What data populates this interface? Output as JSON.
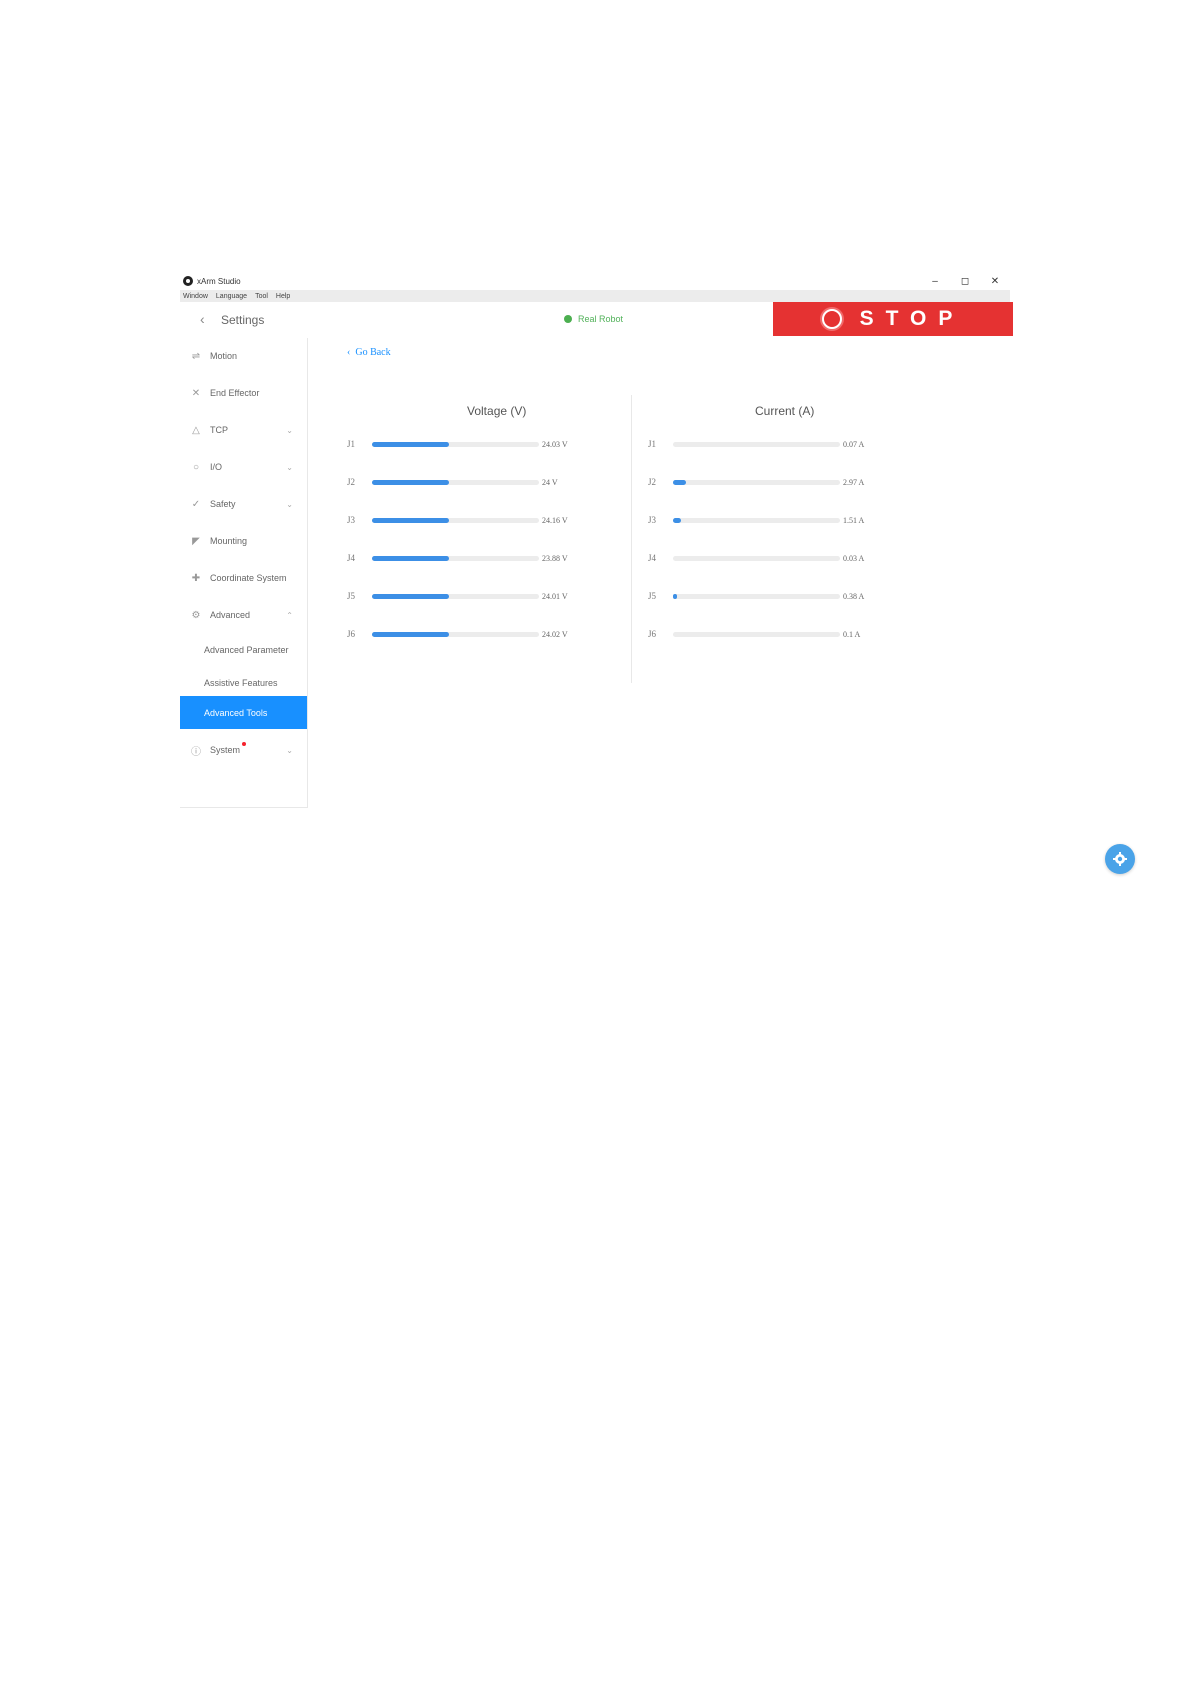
{
  "window": {
    "title": "xArm Studio"
  },
  "menu": [
    "Window",
    "Language",
    "Tool",
    "Help"
  ],
  "header": {
    "title": "Settings",
    "status": "Real Robot",
    "stop_label": "STOP"
  },
  "sidebar": {
    "items": [
      {
        "label": "Motion",
        "icon": "motion-icon"
      },
      {
        "label": "End Effector",
        "icon": "end-effector-icon"
      },
      {
        "label": "TCP",
        "icon": "tcp-icon"
      },
      {
        "label": "I/O",
        "icon": "io-icon"
      },
      {
        "label": "Safety",
        "icon": "safety-icon"
      },
      {
        "label": "Mounting",
        "icon": "mounting-icon"
      },
      {
        "label": "Coordinate System",
        "icon": "coordinate-system-icon"
      },
      {
        "label": "Advanced",
        "icon": "advanced-icon"
      }
    ],
    "sub_items": [
      "Advanced Parameter",
      "Assistive Features",
      "Advanced Tools"
    ],
    "active": "Advanced Tools",
    "system": {
      "label": "System",
      "icon": "info-icon"
    }
  },
  "main": {
    "go_back": "Go Back",
    "voltage": {
      "title": "Voltage (V)",
      "rows": [
        {
          "joint": "J1",
          "value": "24.03 V",
          "level": 0.46
        },
        {
          "joint": "J2",
          "value": "24 V",
          "level": 0.46
        },
        {
          "joint": "J3",
          "value": "24.16 V",
          "level": 0.46
        },
        {
          "joint": "J4",
          "value": "23.88 V",
          "level": 0.46
        },
        {
          "joint": "J5",
          "value": "24.01 V",
          "level": 0.46
        },
        {
          "joint": "J6",
          "value": "24.02 V",
          "level": 0.46
        }
      ]
    },
    "current": {
      "title": "Current (A)",
      "rows": [
        {
          "joint": "J1",
          "value": "0.07 A",
          "level": 0.0
        },
        {
          "joint": "J2",
          "value": "2.97 A",
          "level": 0.08
        },
        {
          "joint": "J3",
          "value": "1.51 A",
          "level": 0.05
        },
        {
          "joint": "J4",
          "value": "0.03 A",
          "level": 0.0
        },
        {
          "joint": "J5",
          "value": "0.38 A",
          "level": 0.01
        },
        {
          "joint": "J6",
          "value": "0.1 A",
          "level": 0.0
        }
      ]
    }
  },
  "colors": {
    "accent": "#1890ff",
    "bar": "#3c8fe6",
    "stop": "#e53232",
    "status": "#4caf50"
  }
}
